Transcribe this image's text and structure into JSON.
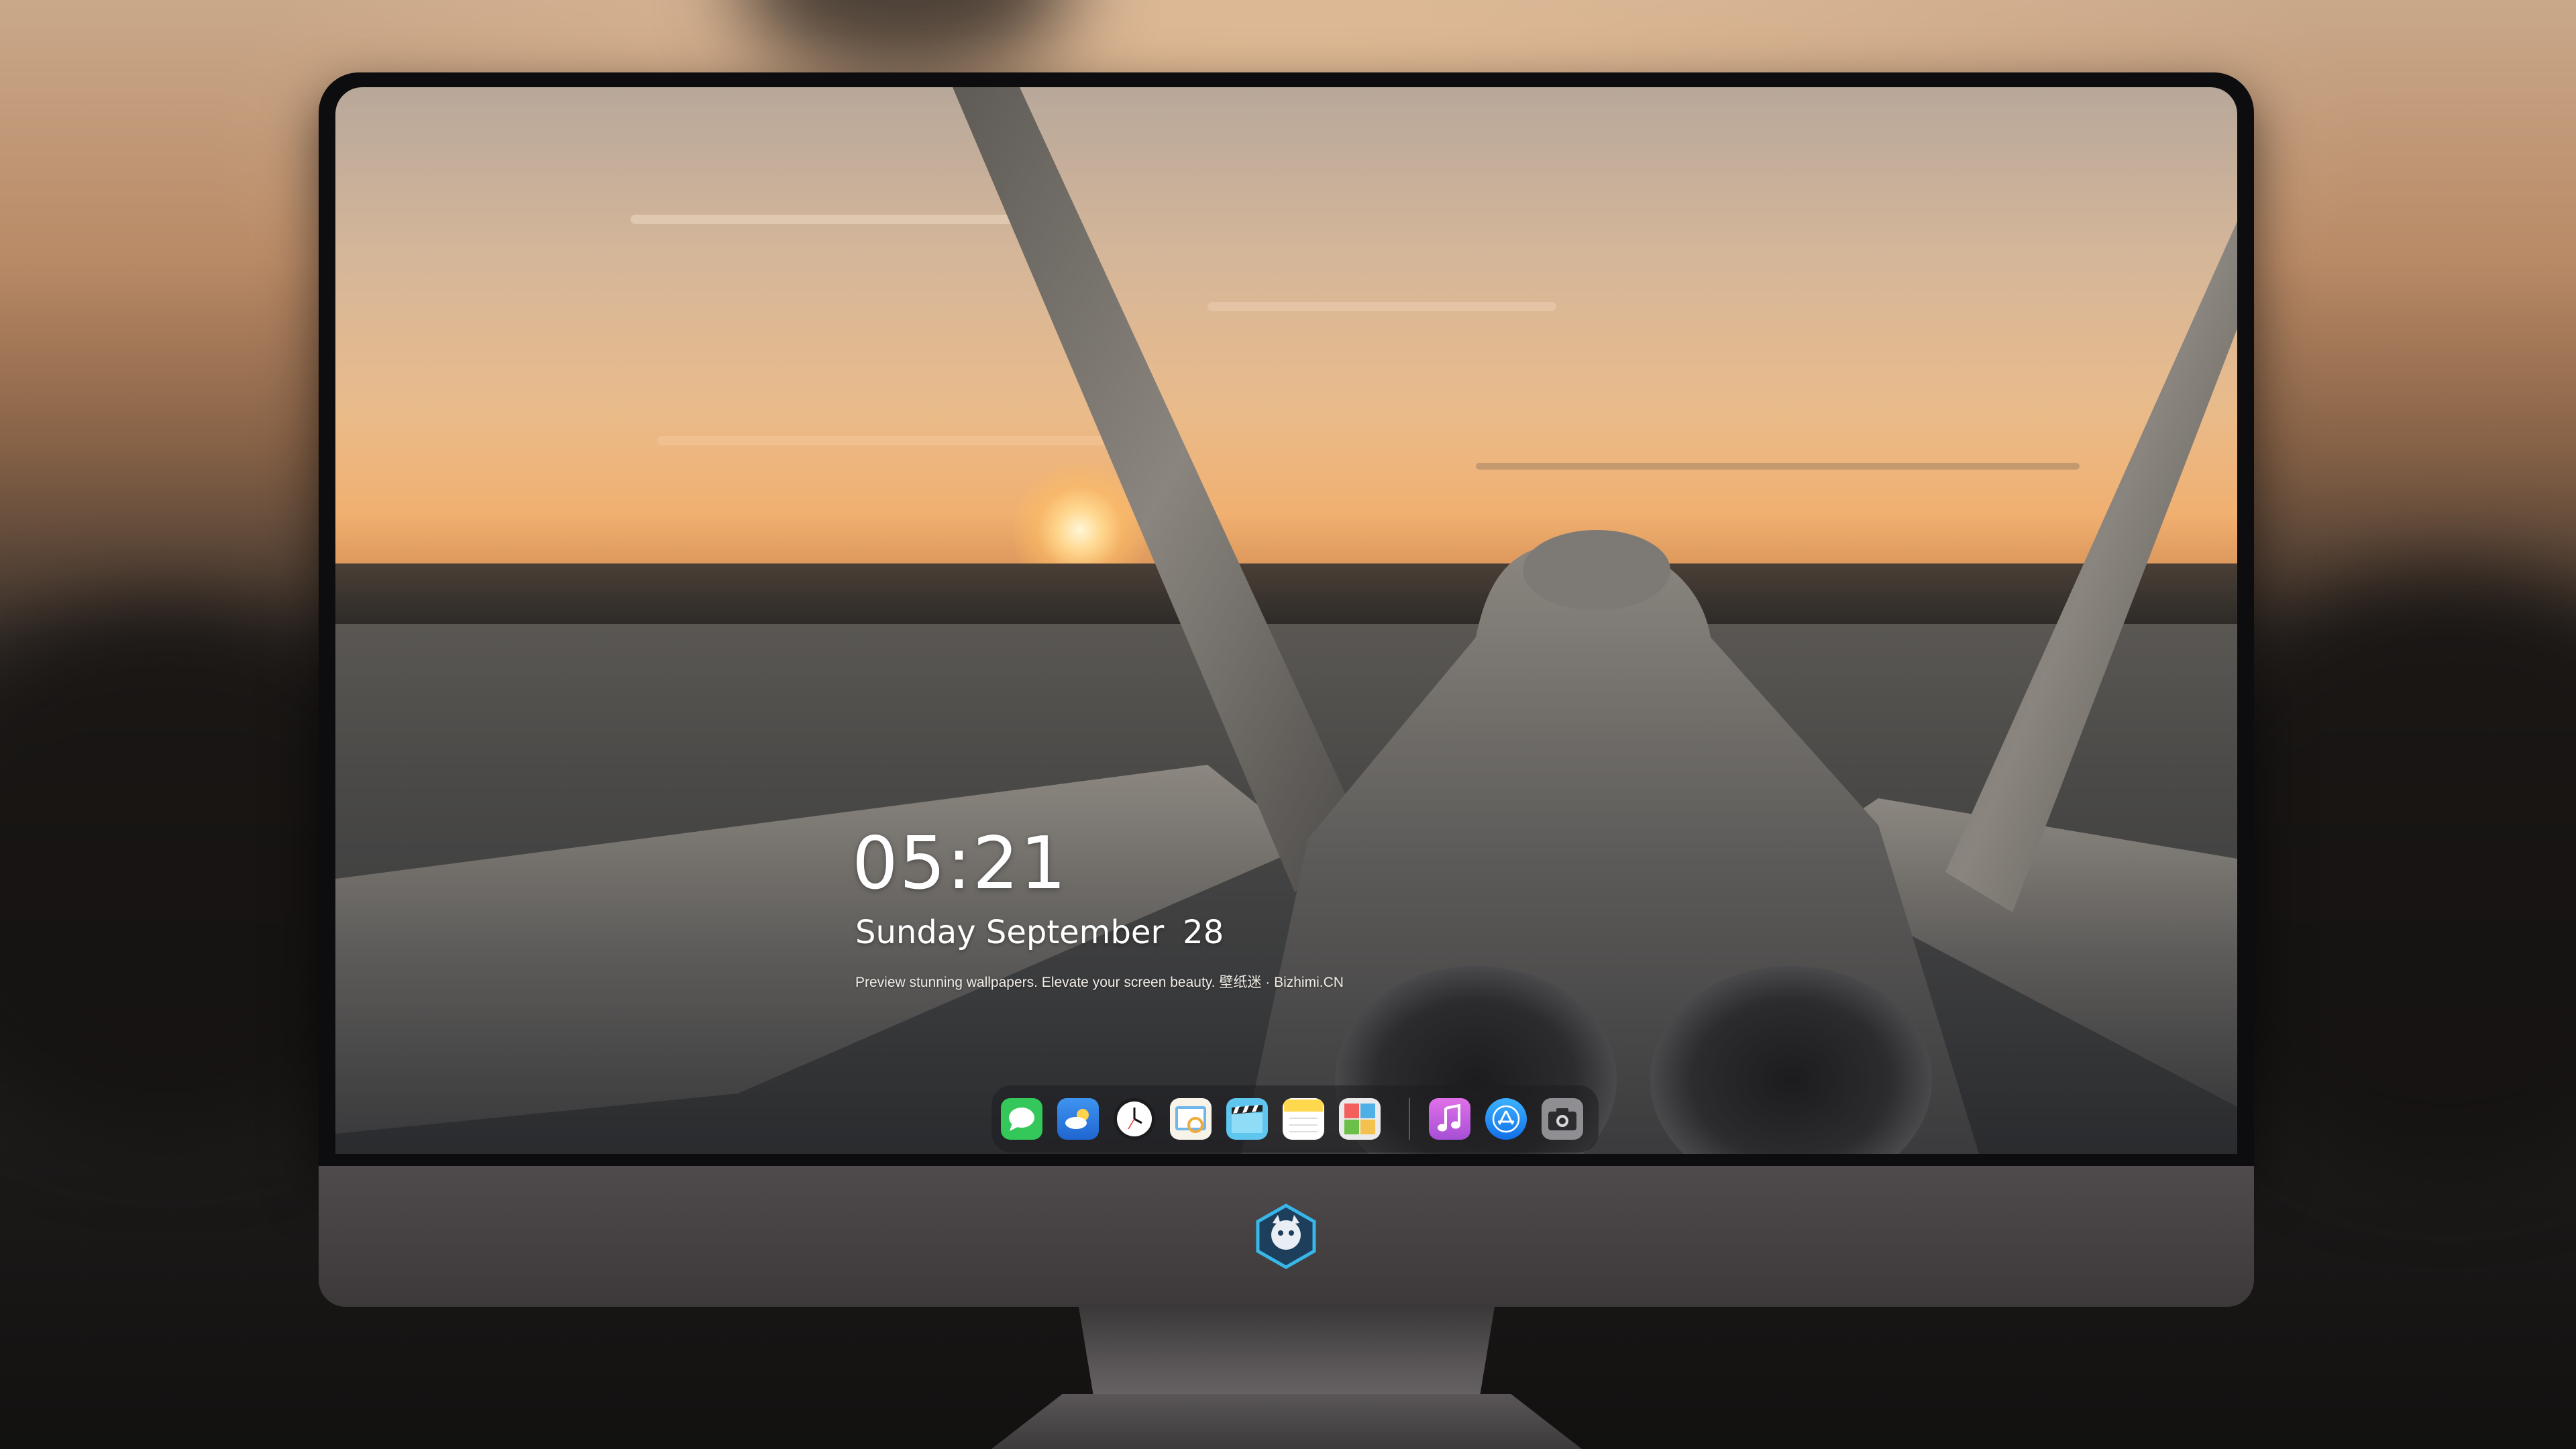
{
  "lock_screen": {
    "time": "05:21",
    "weekday_month": "Sunday September",
    "day": "28",
    "caption": "Preview stunning wallpapers. Elevate your screen beauty. 壁纸迷 · Bizhimi.CN"
  },
  "dock": {
    "apps": [
      {
        "name": "Messages",
        "icon": "messages-icon",
        "color": "#34c759"
      },
      {
        "name": "Weather",
        "icon": "weather-icon",
        "color": "#2f7de1"
      },
      {
        "name": "Clock",
        "icon": "clock-icon",
        "color": "#ffffff"
      },
      {
        "name": "Preview",
        "icon": "preview-icon",
        "color": "#f2c94c"
      },
      {
        "name": "Final Cut Pro",
        "icon": "clapperboard-icon",
        "color": "#5fc6f0"
      },
      {
        "name": "Notes",
        "icon": "notes-icon",
        "color": "#ffd84d"
      },
      {
        "name": "Photo Booth",
        "icon": "photos-icon",
        "color": "#e8e8e8"
      },
      {
        "name": "iTunes",
        "icon": "music-icon",
        "color": "#c86dd7"
      },
      {
        "name": "App Store",
        "icon": "app-store-icon",
        "color": "#1a8cff"
      },
      {
        "name": "Screenshot",
        "icon": "camera-icon",
        "color": "#8e8e93"
      }
    ]
  },
  "colors": {
    "sky_top": "#b8a89a",
    "sky_glow": "#f0b070",
    "runway": "#3a3b3d",
    "bezel": "#0d0d0f",
    "chin": "#4a4546",
    "logo_accent": "#38b6e8"
  }
}
